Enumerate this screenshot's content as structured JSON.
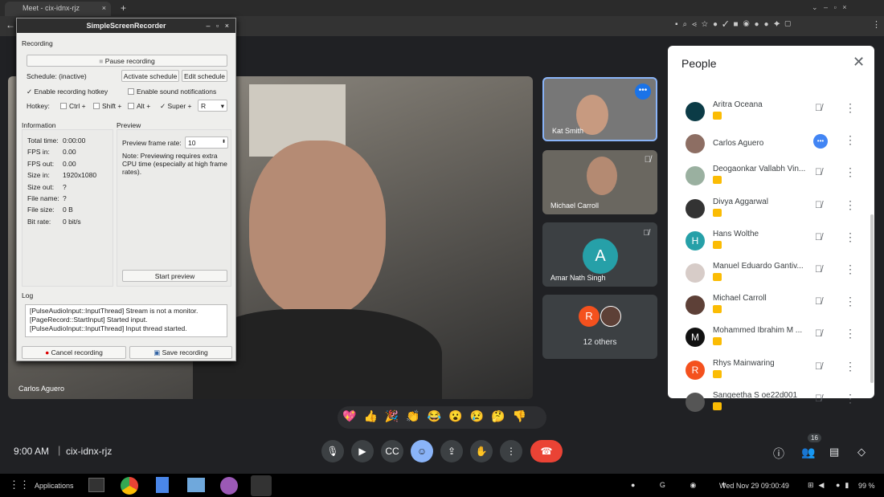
{
  "browser": {
    "tab_title": "Meet - cix-idnx-rjz",
    "new_tab": "+"
  },
  "ssr": {
    "title": "SimpleScreenRecorder",
    "recording_section": "Recording",
    "pause_label": "Pause recording",
    "schedule_status": "Schedule: (inactive)",
    "activate_schedule": "Activate schedule",
    "edit_schedule": "Edit schedule",
    "enable_hotkey": "Enable recording hotkey",
    "enable_sound": "Enable sound notifications",
    "hotkey_label": "Hotkey:",
    "ctrl": "Ctrl +",
    "shift": "Shift +",
    "alt": "Alt +",
    "super": "Super +",
    "key": "R",
    "info_section": "Information",
    "preview_section": "Preview",
    "info": [
      {
        "k": "Total time:",
        "v": "0:00:00"
      },
      {
        "k": "FPS in:",
        "v": "0.00"
      },
      {
        "k": "FPS out:",
        "v": "0.00"
      },
      {
        "k": "Size in:",
        "v": "1920x1080"
      },
      {
        "k": "Size out:",
        "v": "?"
      },
      {
        "k": "File name:",
        "v": "?"
      },
      {
        "k": "File size:",
        "v": "0 B"
      },
      {
        "k": "Bit rate:",
        "v": "0 bit/s"
      }
    ],
    "preview_rate_label": "Preview frame rate:",
    "preview_rate": "10",
    "preview_note": "Note: Previewing requires extra CPU time (especially at high frame rates).",
    "start_preview": "Start preview",
    "log_section": "Log",
    "log": [
      "[PulseAudioInput::InputThread] Stream is not a monitor.",
      "[PageRecord::StartInput] Started input.",
      "[PulseAudioInput::InputThread] Input thread started."
    ],
    "cancel": "Cancel recording",
    "save": "Save recording"
  },
  "meet": {
    "main_speaker": "Carlos Aguero",
    "tiles": [
      "Kat Smith",
      "Michael Carroll",
      "Amar Nath Singh",
      "12 others"
    ],
    "amar_initial": "A",
    "others_initial": "R",
    "time": "9:00 AM",
    "code": "cix-idnx-rjz",
    "people_count": "16",
    "emojis": [
      "💖",
      "👍",
      "🎉",
      "👏",
      "😂",
      "😮",
      "😢",
      "🤔",
      "👎"
    ]
  },
  "people": {
    "title": "People",
    "list": [
      {
        "name": "Aritra Oceana",
        "color": "#0b3b46",
        "init": ""
      },
      {
        "name": "Carlos Aguero",
        "color": "#8d6e63",
        "init": "",
        "speaking": true
      },
      {
        "name": "Deogaonkar Vallabh Vin...",
        "color": "#9ab0a0",
        "init": ""
      },
      {
        "name": "Divya Aggarwal",
        "color": "#333",
        "init": ""
      },
      {
        "name": "Hans Wolthe",
        "color": "#26a0a8",
        "init": "H"
      },
      {
        "name": "Manuel Eduardo Gantiv...",
        "color": "#d7ccc8",
        "init": ""
      },
      {
        "name": "Michael Carroll",
        "color": "#5d4037",
        "init": ""
      },
      {
        "name": "Mohammed Ibrahim M ...",
        "color": "#111",
        "init": "M"
      },
      {
        "name": "Rhys Mainwaring",
        "color": "#f4511e",
        "init": "R"
      },
      {
        "name": "Sangeetha S oe22d001",
        "color": "#555",
        "init": ""
      }
    ]
  },
  "taskbar": {
    "applications": "Applications",
    "clock": "Wed Nov 29  09:00:49",
    "battery": "99 %"
  }
}
